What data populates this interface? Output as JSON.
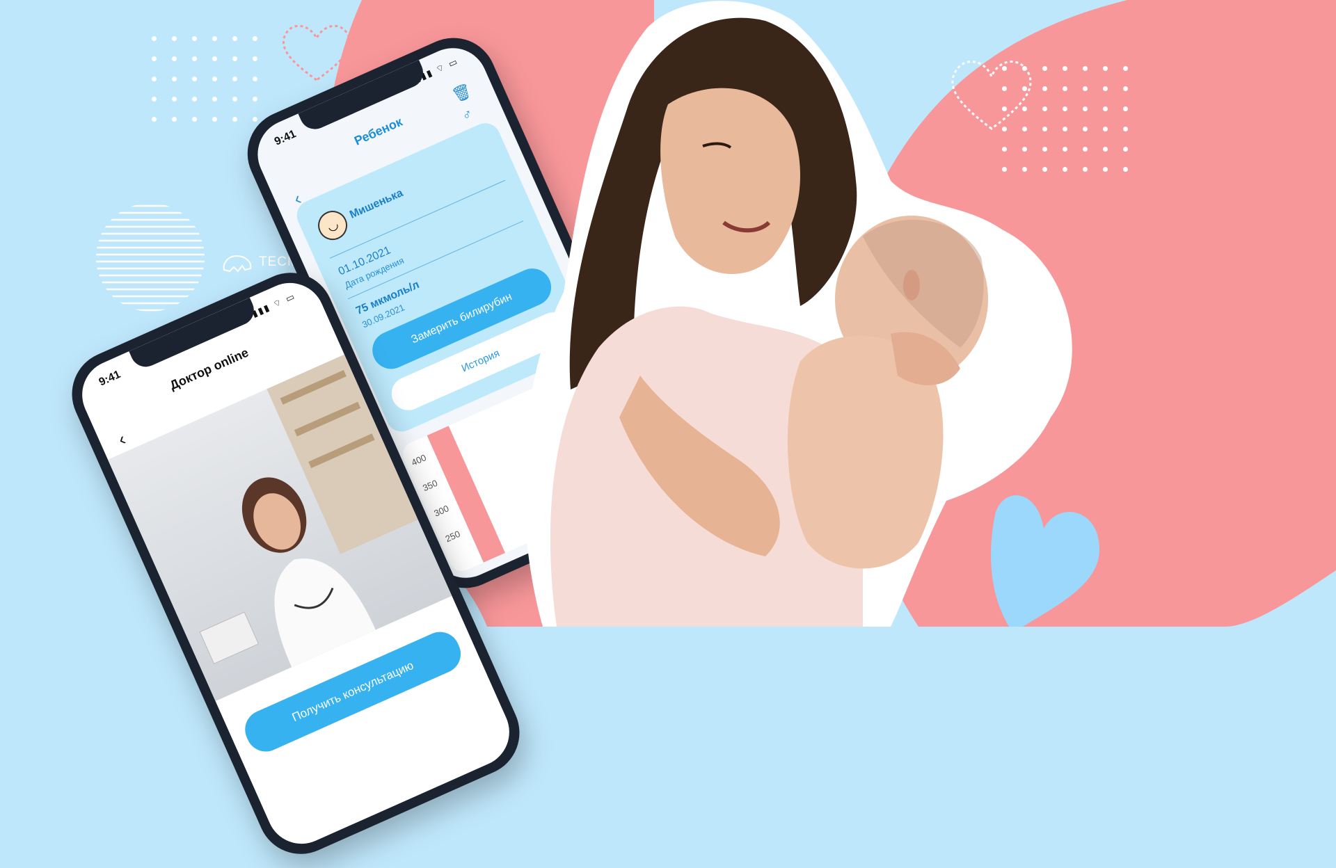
{
  "brand": {
    "name": "TECMAN"
  },
  "phone_child": {
    "status_time": "9:41",
    "title": "Ребенок",
    "child_name": "Мишенька",
    "birth_date": "01.10.2021",
    "birth_date_label": "Дата рождения",
    "bilirubin_value": "75 мкмоль/л",
    "bilirubin_date": "30.09.2021",
    "measure_button": "Замерить билирубин",
    "history_button": "История",
    "chart_ticks": [
      "400",
      "350",
      "300",
      "250"
    ]
  },
  "phone_doctor": {
    "status_time": "9:41",
    "title": "Доктор online",
    "consult_button": "Получить консультацию"
  },
  "colors": {
    "sky": "#bfe7fb",
    "pink": "#f8979a",
    "accent": "#37b2f0"
  }
}
